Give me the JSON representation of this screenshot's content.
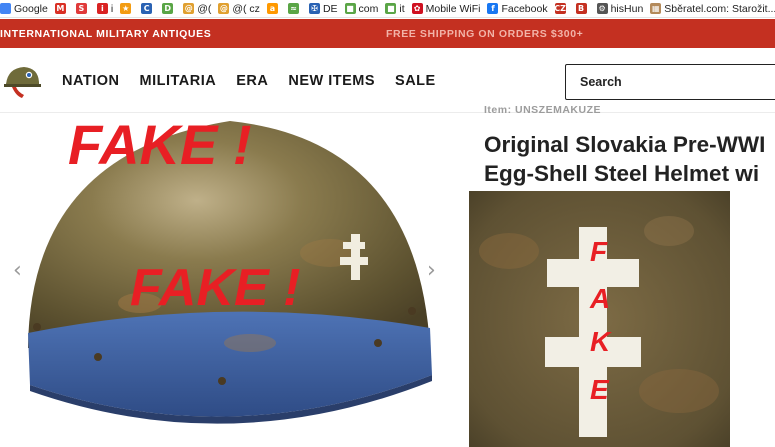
{
  "bookmarks": [
    {
      "label": "Google",
      "icon": "google-icon",
      "color": "#4285f4",
      "glyph": ""
    },
    {
      "label": "",
      "icon": "gmail-icon",
      "color": "#d93025",
      "glyph": "M"
    },
    {
      "label": "",
      "icon": "s-icon",
      "color": "#e03a3a",
      "glyph": "S"
    },
    {
      "label": "i",
      "icon": "i-icon",
      "color": "#d92323",
      "glyph": "i"
    },
    {
      "label": "",
      "icon": "star-icon",
      "color": "#f39c12",
      "glyph": "★"
    },
    {
      "label": "",
      "icon": "c-icon",
      "color": "#2a62b3",
      "glyph": "C"
    },
    {
      "label": "",
      "icon": "d-icon",
      "color": "#5aa546",
      "glyph": "D"
    },
    {
      "label": "@(",
      "icon": "at-icon",
      "color": "#e0a030",
      "glyph": "@"
    },
    {
      "label": "@( cz",
      "icon": "at-cz-icon",
      "color": "#e0a030",
      "glyph": "@"
    },
    {
      "label": "",
      "icon": "amazon-icon",
      "color": "#ff9900",
      "glyph": "a"
    },
    {
      "label": "",
      "icon": "bird-icon",
      "color": "#5aa546",
      "glyph": "≈"
    },
    {
      "label": "DE",
      "icon": "slovakia-flag-icon",
      "color": "#2a62b3",
      "glyph": "✠"
    },
    {
      "label": "com",
      "icon": "bag-icon",
      "color": "#5aa546",
      "glyph": "■"
    },
    {
      "label": "it",
      "icon": "bag-it-icon",
      "color": "#5aa546",
      "glyph": "■"
    },
    {
      "label": "Mobile WiFi",
      "icon": "huawei-icon",
      "color": "#cf1020",
      "glyph": "✿"
    },
    {
      "label": "Facebook",
      "icon": "facebook-icon",
      "color": "#1877f2",
      "glyph": "f"
    },
    {
      "label": "",
      "icon": "cz-icon",
      "color": "#c43021",
      "glyph": "CZ"
    },
    {
      "label": "",
      "icon": "b-icon",
      "color": "#c43021",
      "glyph": "B"
    },
    {
      "label": "hisHun",
      "icon": "gear-icon",
      "color": "#555555",
      "glyph": "⚙"
    },
    {
      "label": "Sběratel.com: Starožit...",
      "icon": "sberatel-icon",
      "color": "#b48a5a",
      "glyph": "▦"
    }
  ],
  "topbar": {
    "left_text": "INTERNATIONAL MILITARY ANTIQUES",
    "right_text": "FREE SHIPPING ON ORDERS $300+"
  },
  "nav": [
    "NATION",
    "MILITARIA",
    "ERA",
    "NEW ITEMS",
    "SALE"
  ],
  "search": {
    "label": "Search"
  },
  "product": {
    "vendor": "Item: UNSZEMAKUZE",
    "title_line1": "Original Slovakia Pre-WWI",
    "title_line2": "Egg-Shell Steel Helmet wi"
  },
  "annotations": {
    "fake_top": "FAKE !",
    "fake_middle": "FAKE !",
    "fake_vertical": [
      "F",
      "A",
      "K",
      "E"
    ]
  },
  "gallery": {
    "prev_arrow": "‹",
    "next_arrow": "›"
  },
  "colors": {
    "brand_red": "#c43021",
    "fake_red": "#e81f24",
    "helmet_olive": "#6b6033",
    "helmet_band_blue": "#3c5f9e"
  }
}
